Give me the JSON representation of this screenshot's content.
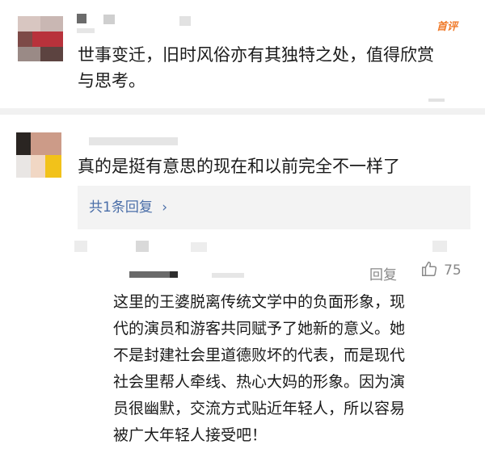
{
  "comments": [
    {
      "badge": "首评",
      "text_lines": [
        "世事变迁，旧时风俗亦有其独特之处，值得欣赏",
        "与思考。"
      ]
    },
    {
      "text": "真的是挺有意思的现在和以前完全不一样了",
      "reply_summary": "共1条回复",
      "reply_chevron": "›"
    }
  ],
  "reply": {
    "actions": {
      "reply_label": "回复",
      "like_icon": "thumbs-up-icon",
      "like_count": "75"
    },
    "text_lines": [
      "这里的王婆脱离传统文学中的负面形象，现",
      "代的演员和游客共同赋予了她新的意义。她",
      "不是封建社会里道德败坏的代表，而是现代",
      "社会里帮人牵线、热心大妈的形象。因为演",
      "员很幽默，交流方式贴近年轻人，所以容易",
      "被广大年轻人接受吧！"
    ]
  },
  "colors": {
    "badge": "#f07a2a",
    "link": "#4a6ea8",
    "muted": "#888888",
    "reply_bg": "#f3f3f3"
  }
}
